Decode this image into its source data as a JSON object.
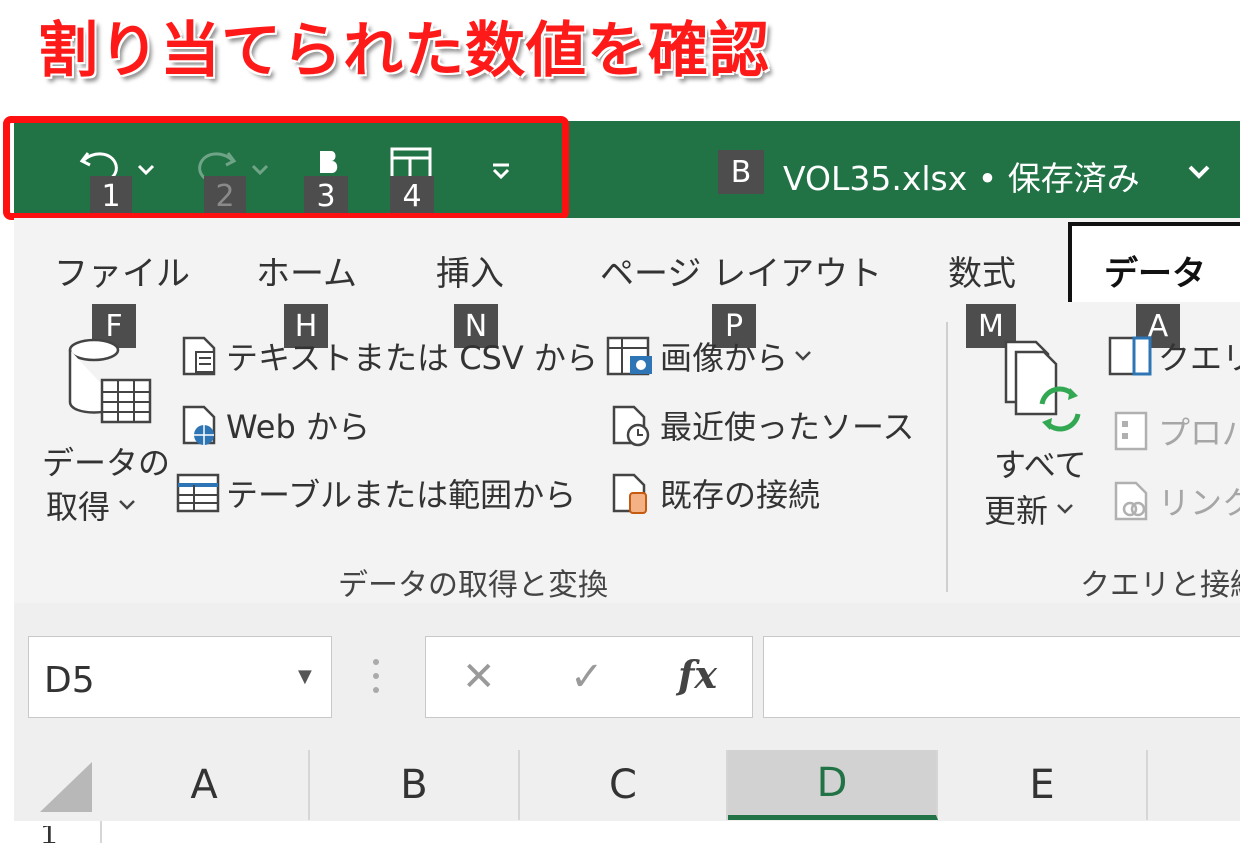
{
  "headline": "割り当てられた数値を確認",
  "colors": {
    "excel_green": "#217346",
    "highlight_red": "#ff1010"
  },
  "quick_access": {
    "undo_icon": "undo-icon",
    "redo_icon": "redo-icon",
    "autosave_icon": "bold-b-icon",
    "layout_icon": "layout-icon",
    "customize_icon": "customize-qat-icon",
    "keytips": [
      "1",
      "2",
      "3",
      "4"
    ]
  },
  "titlebar": {
    "keytip": "B",
    "filename": "VOL35.xlsx • 保存済み"
  },
  "tabs": [
    {
      "label": "ファイル",
      "keytip": "F"
    },
    {
      "label": "ホーム",
      "keytip": "H"
    },
    {
      "label": "挿入",
      "keytip": "N"
    },
    {
      "label": "ページ レイアウト",
      "keytip": "P"
    },
    {
      "label": "数式",
      "keytip": "M"
    },
    {
      "label": "データ",
      "keytip": "A"
    }
  ],
  "ribbon": {
    "get_data": {
      "line1": "データの",
      "line2": "取得"
    },
    "commands_left": [
      "テキストまたは CSV から",
      "Web から",
      "テーブルまたは範囲から"
    ],
    "commands_mid": [
      "画像から",
      "最近使ったソース",
      "既存の接続"
    ],
    "group1_label": "データの取得と変換",
    "refresh": {
      "line1": "すべて",
      "line2": "更新"
    },
    "commands_right": [
      "クエリと",
      "プロパ",
      "リンクの"
    ],
    "group2_label": "クエリと接続"
  },
  "formula_bar": {
    "cell_ref": "D5",
    "cancel": "✕",
    "enter": "✓",
    "fx": "fx"
  },
  "columns": [
    "A",
    "B",
    "C",
    "D",
    "E"
  ],
  "selected_column": "D",
  "row_number": "1"
}
